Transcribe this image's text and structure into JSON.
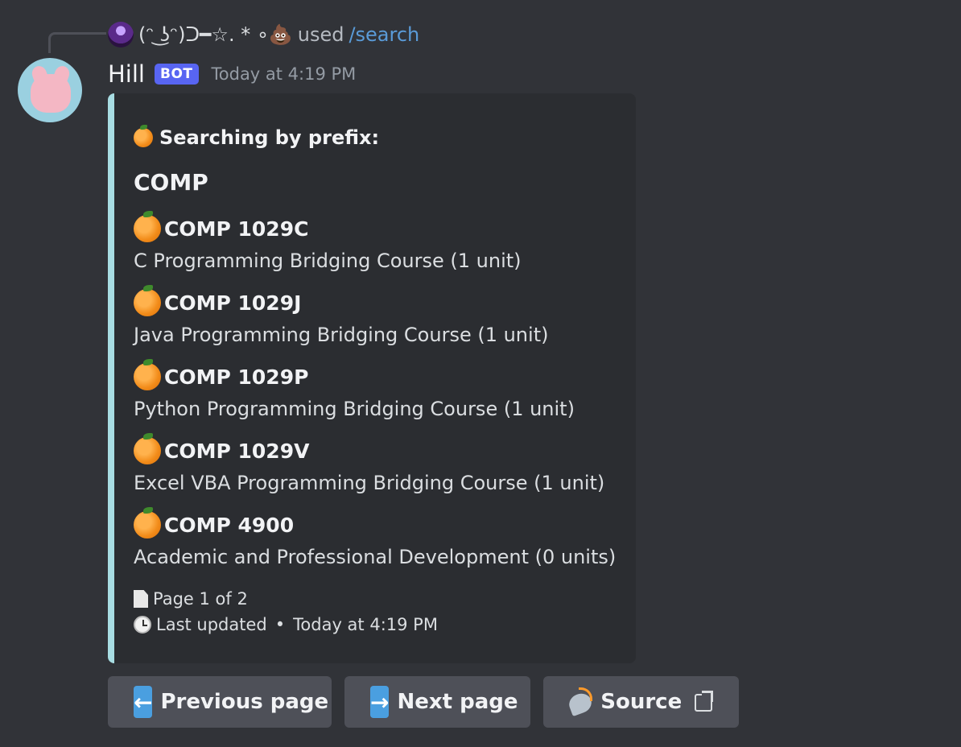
{
  "reply": {
    "name": "(ᵔ ͜ʖᵔ)ᑐ━☆. * ∘💩",
    "used_text": "used",
    "command": "/search"
  },
  "header": {
    "username": "Hill",
    "bot_tag": "BOT",
    "timestamp": "Today at 4:19 PM"
  },
  "embed": {
    "accent_color": "#a8dde3",
    "author": "Searching by prefix:",
    "title": "COMP",
    "fields": [
      {
        "name": "COMP 1029C",
        "value": "C Programming Bridging Course (1 unit)"
      },
      {
        "name": "COMP 1029J",
        "value": "Java Programming Bridging Course (1 unit)"
      },
      {
        "name": "COMP 1029P",
        "value": "Python Programming Bridging Course (1 unit)"
      },
      {
        "name": "COMP 1029V",
        "value": "Excel VBA Programming Bridging Course (1 unit)"
      },
      {
        "name": "COMP 4900",
        "value": "Academic and Professional Development (0 units)"
      }
    ],
    "footer": {
      "page": "Page 1 of 2",
      "last_updated": "Last updated",
      "timestamp": "Today at 4:19 PM"
    }
  },
  "buttons": {
    "previous": "Previous page",
    "next": "Next page",
    "source": "Source"
  },
  "icons": {
    "field_icon": "orange-icon",
    "page_icon": "document-icon",
    "clock": "clock-icon",
    "previous": "left-arrow-icon",
    "next": "right-arrow-icon",
    "source": "satellite-icon",
    "external": "external-link-icon"
  }
}
